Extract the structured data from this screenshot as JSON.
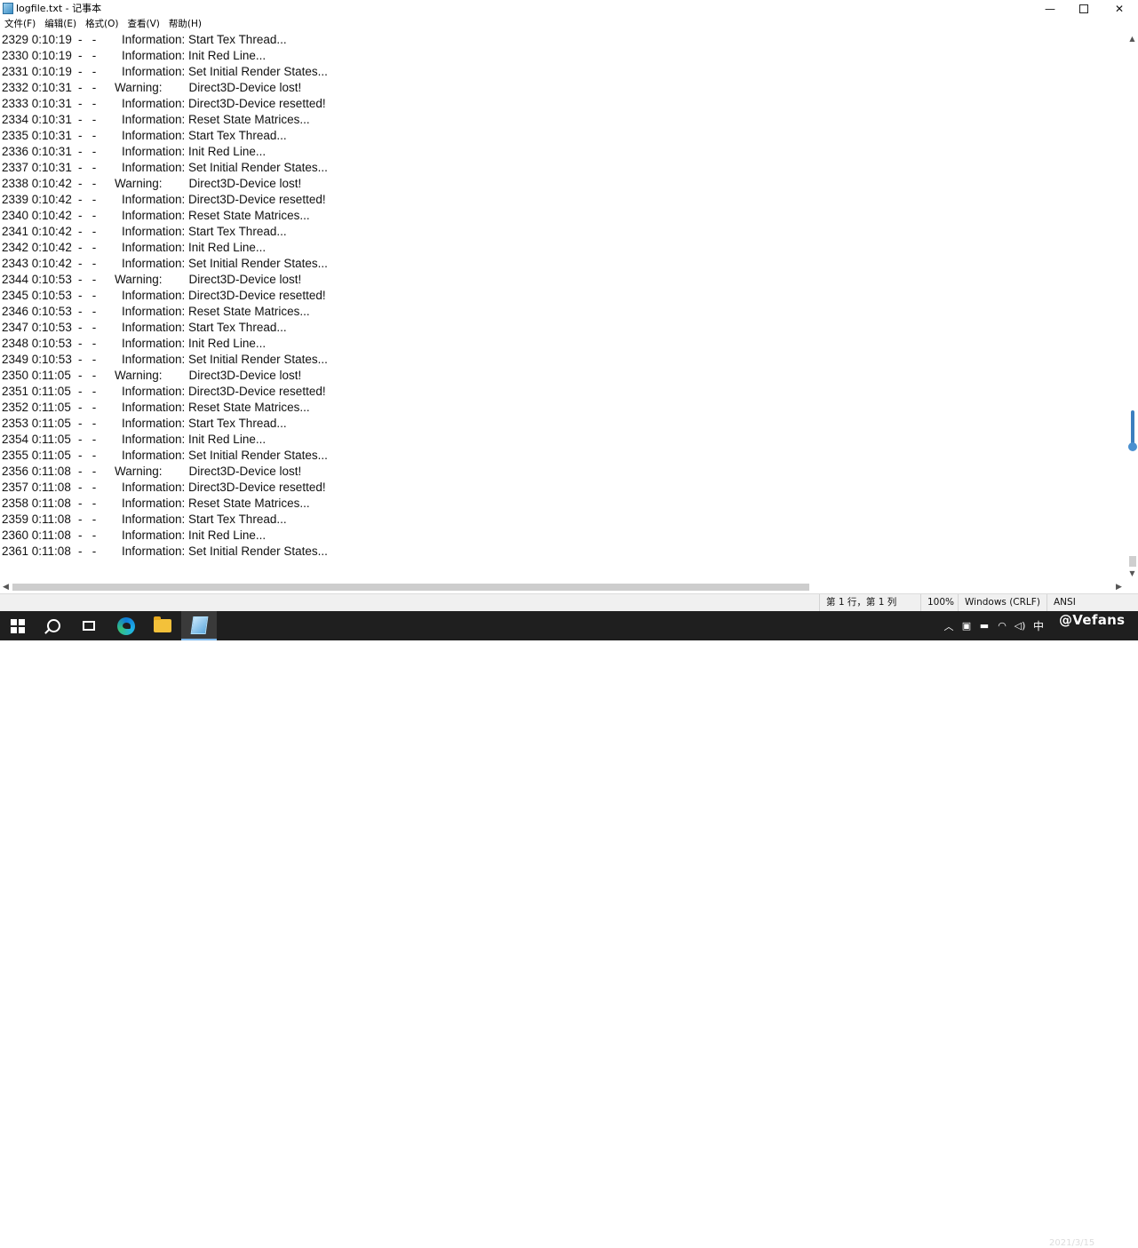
{
  "window": {
    "title": "logfile.txt - 记事本",
    "minimize_label": "—",
    "close_label": "✕"
  },
  "menu": [
    {
      "label": "文件(F)"
    },
    {
      "label": "编辑(E)"
    },
    {
      "label": "格式(O)"
    },
    {
      "label": "查看(V)"
    },
    {
      "label": "帮助(H)"
    }
  ],
  "lines": [
    {
      "id": "2329 0:10:19",
      "dash": "-   -",
      "level": "",
      "msg": "Information: Start Tex Thread..."
    },
    {
      "id": "2330 0:10:19",
      "dash": "-   -",
      "level": "",
      "msg": "Information: Init Red Line..."
    },
    {
      "id": "2331 0:10:19",
      "dash": "-   -",
      "level": "",
      "msg": "Information: Set Initial Render States..."
    },
    {
      "id": "2332 0:10:31",
      "dash": "-   -",
      "level": "warn",
      "msg": "Warning:        Direct3D-Device lost!"
    },
    {
      "id": "2333 0:10:31",
      "dash": "-   -",
      "level": "",
      "msg": "Information: Direct3D-Device resetted!"
    },
    {
      "id": "2334 0:10:31",
      "dash": "-   -",
      "level": "",
      "msg": "Information: Reset State Matrices..."
    },
    {
      "id": "2335 0:10:31",
      "dash": "-   -",
      "level": "",
      "msg": "Information: Start Tex Thread..."
    },
    {
      "id": "2336 0:10:31",
      "dash": "-   -",
      "level": "",
      "msg": "Information: Init Red Line..."
    },
    {
      "id": "2337 0:10:31",
      "dash": "-   -",
      "level": "",
      "msg": "Information: Set Initial Render States..."
    },
    {
      "id": "2338 0:10:42",
      "dash": "-   -",
      "level": "warn",
      "msg": "Warning:        Direct3D-Device lost!"
    },
    {
      "id": "2339 0:10:42",
      "dash": "-   -",
      "level": "",
      "msg": "Information: Direct3D-Device resetted!"
    },
    {
      "id": "2340 0:10:42",
      "dash": "-   -",
      "level": "",
      "msg": "Information: Reset State Matrices..."
    },
    {
      "id": "2341 0:10:42",
      "dash": "-   -",
      "level": "",
      "msg": "Information: Start Tex Thread..."
    },
    {
      "id": "2342 0:10:42",
      "dash": "-   -",
      "level": "",
      "msg": "Information: Init Red Line..."
    },
    {
      "id": "2343 0:10:42",
      "dash": "-   -",
      "level": "",
      "msg": "Information: Set Initial Render States..."
    },
    {
      "id": "2344 0:10:53",
      "dash": "-   -",
      "level": "warn",
      "msg": "Warning:        Direct3D-Device lost!"
    },
    {
      "id": "2345 0:10:53",
      "dash": "-   -",
      "level": "",
      "msg": "Information: Direct3D-Device resetted!"
    },
    {
      "id": "2346 0:10:53",
      "dash": "-   -",
      "level": "",
      "msg": "Information: Reset State Matrices..."
    },
    {
      "id": "2347 0:10:53",
      "dash": "-   -",
      "level": "",
      "msg": "Information: Start Tex Thread..."
    },
    {
      "id": "2348 0:10:53",
      "dash": "-   -",
      "level": "",
      "msg": "Information: Init Red Line..."
    },
    {
      "id": "2349 0:10:53",
      "dash": "-   -",
      "level": "",
      "msg": "Information: Set Initial Render States..."
    },
    {
      "id": "2350 0:11:05",
      "dash": "-   -",
      "level": "warn",
      "msg": "Warning:        Direct3D-Device lost!"
    },
    {
      "id": "2351 0:11:05",
      "dash": "-   -",
      "level": "",
      "msg": "Information: Direct3D-Device resetted!"
    },
    {
      "id": "2352 0:11:05",
      "dash": "-   -",
      "level": "",
      "msg": "Information: Reset State Matrices..."
    },
    {
      "id": "2353 0:11:05",
      "dash": "-   -",
      "level": "",
      "msg": "Information: Start Tex Thread..."
    },
    {
      "id": "2354 0:11:05",
      "dash": "-   -",
      "level": "",
      "msg": "Information: Init Red Line..."
    },
    {
      "id": "2355 0:11:05",
      "dash": "-   -",
      "level": "",
      "msg": "Information: Set Initial Render States..."
    },
    {
      "id": "2356 0:11:08",
      "dash": "-   -",
      "level": "warn",
      "msg": "Warning:        Direct3D-Device lost!"
    },
    {
      "id": "2357 0:11:08",
      "dash": "-   -",
      "level": "",
      "msg": "Information: Direct3D-Device resetted!"
    },
    {
      "id": "2358 0:11:08",
      "dash": "-   -",
      "level": "",
      "msg": "Information: Reset State Matrices..."
    },
    {
      "id": "2359 0:11:08",
      "dash": "-   -",
      "level": "",
      "msg": "Information: Start Tex Thread..."
    },
    {
      "id": "2360 0:11:08",
      "dash": "-   -",
      "level": "",
      "msg": "Information: Init Red Line..."
    },
    {
      "id": "2361 0:11:08",
      "dash": "-   -",
      "level": "",
      "msg": "Information: Set Initial Render States..."
    }
  ],
  "status": {
    "position": "第 1 行，第 1 列",
    "zoom": "100%",
    "line_ending": "Windows (CRLF)",
    "encoding": "ANSI"
  },
  "taskbar": {
    "ime": "中",
    "watermark": "@Vefans",
    "date": "2021/3/15"
  },
  "icons": {
    "app": "notepad-icon",
    "start": "windows-logo-icon",
    "search": "search-icon",
    "taskview": "task-view-icon",
    "edge": "edge-icon",
    "explorer": "folder-icon",
    "notepad": "notepad-icon"
  },
  "colors": {
    "accent": "#3c7fbf",
    "taskbar": "#1f1f1f",
    "statusbar": "#f0f0f0"
  }
}
